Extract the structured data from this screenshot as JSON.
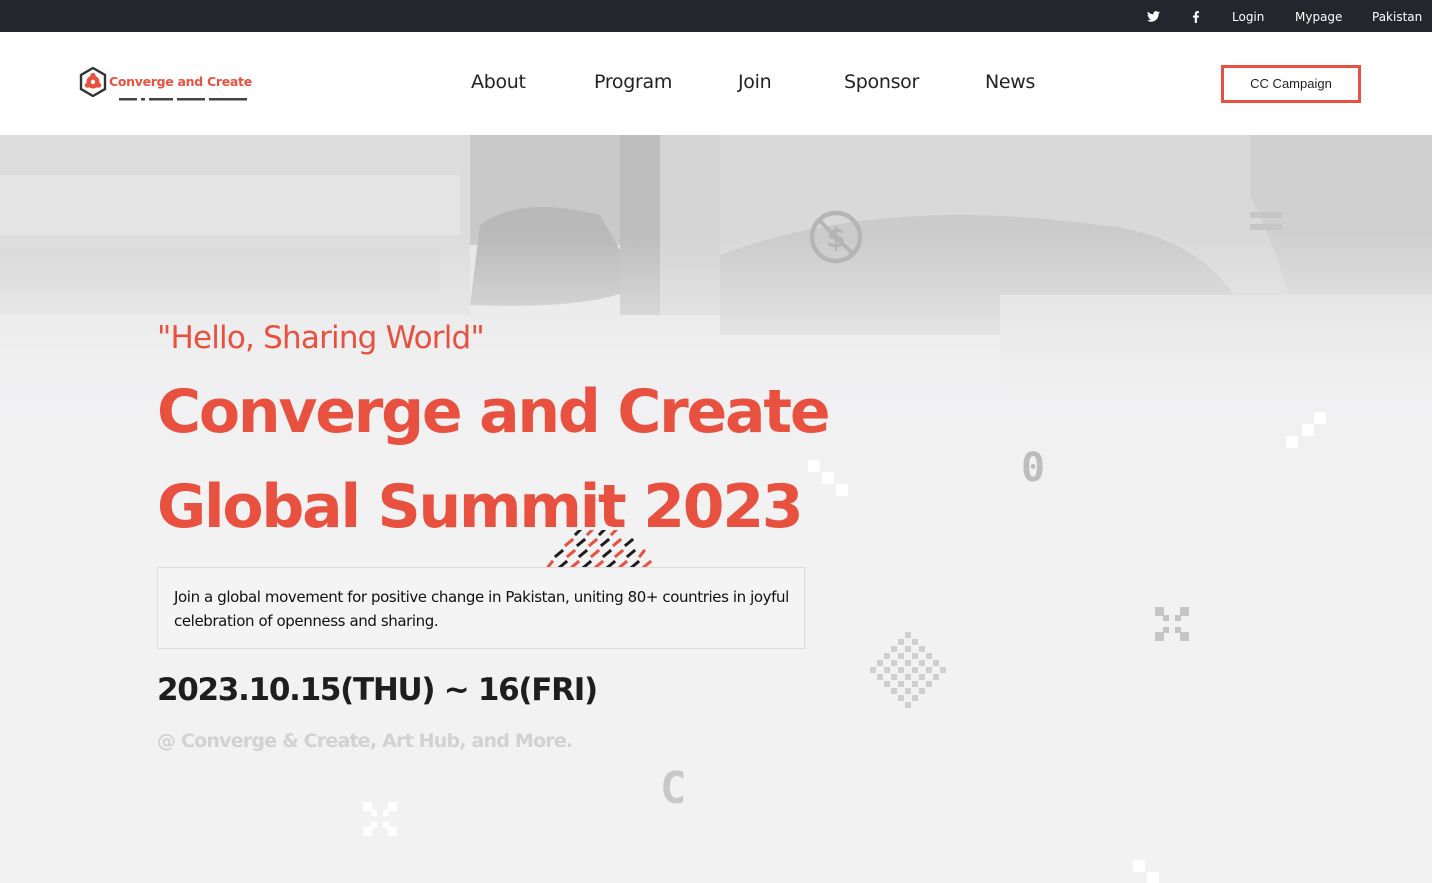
{
  "topbar": {
    "twitter_icon": "twitter-icon",
    "facebook_icon": "facebook-icon",
    "login": "Login",
    "mypage": "Mypage",
    "region": "Pakistan"
  },
  "header": {
    "logo_text": "Converge and Create",
    "nav": [
      "About",
      "Program",
      "Join",
      "Sponsor",
      "News"
    ],
    "campaign_button": "CC Campaign"
  },
  "hero": {
    "tagline": "\"Hello, Sharing World\"",
    "title_line1": "Converge and Create",
    "title_line2": "Global Summit 2023",
    "description": "Join a global movement for positive change in Pakistan, uniting 80+ countries in joyful celebration of openness and sharing.",
    "date": "2023.10.15(THU) ~ 16(FRI)",
    "venue": "@ Converge & Create, Art Hub, and More.",
    "deco_zero": "0",
    "deco_c": "C"
  },
  "colors": {
    "accent": "#e8513f",
    "topbar_bg": "#24262e",
    "hero_bg": "#f2f2f3",
    "text_dark": "#1e1e1e",
    "venue_gray": "#d2d2d2"
  }
}
